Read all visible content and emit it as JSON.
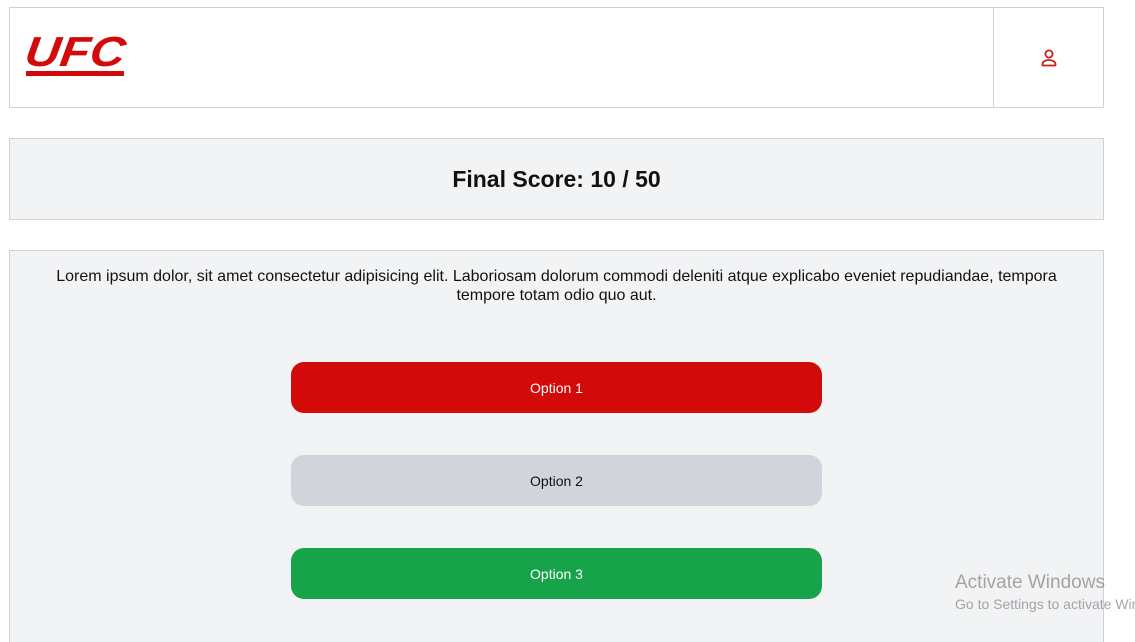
{
  "header": {
    "logo_text": "UFC",
    "brand_color": "#d20a0a",
    "user_icon": "user-icon"
  },
  "score": {
    "label": "Final Score: 10 / 50",
    "value": 10,
    "max": 50
  },
  "question": {
    "text": "Lorem ipsum dolor, sit amet consectetur adipisicing elit. Laboriosam dolorum commodi deleniti atque explicabo eveniet repudiandae, tempora tempore totam odio quo aut."
  },
  "options": [
    {
      "label": "Option 1",
      "state": "wrong",
      "color": "#d20a0a"
    },
    {
      "label": "Option 2",
      "state": "neutral",
      "color": "#d1d4db"
    },
    {
      "label": "Option 3",
      "state": "correct",
      "color": "#16a34a"
    }
  ],
  "watermark": {
    "title": "Activate Windows",
    "subtitle": "Go to Settings to activate Windows."
  }
}
